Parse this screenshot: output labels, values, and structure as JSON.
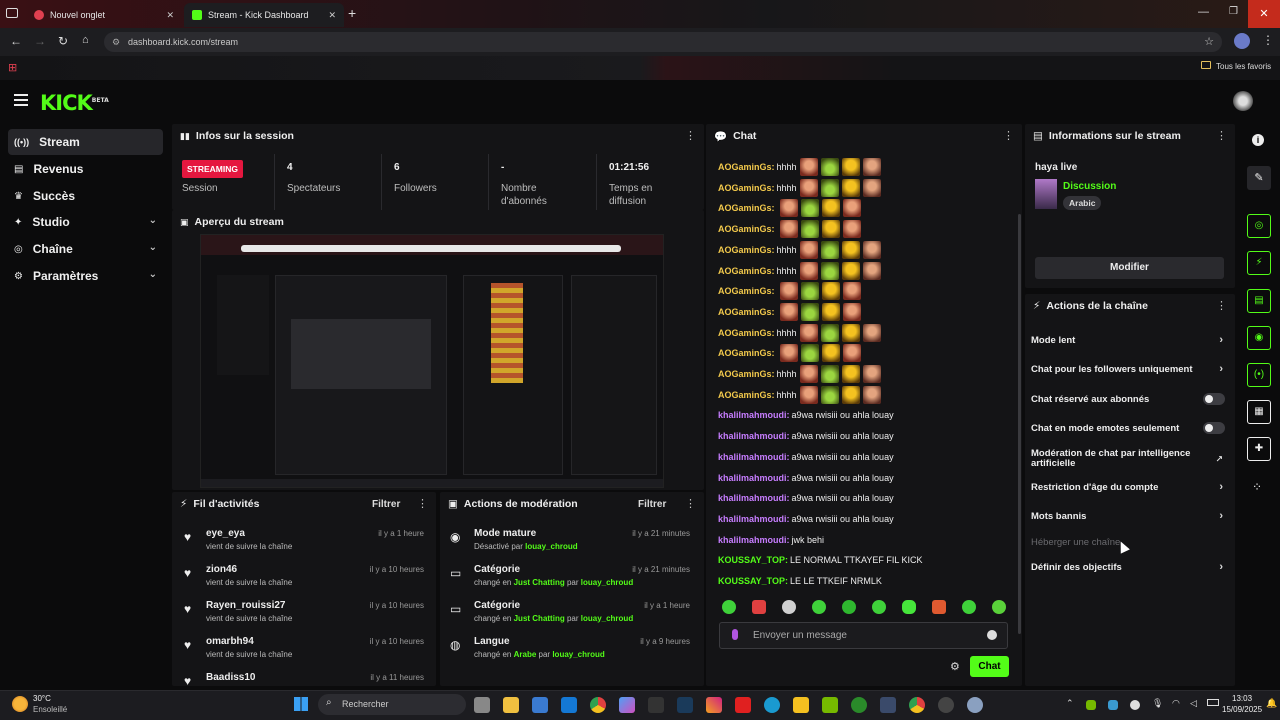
{
  "browser": {
    "tabs": [
      {
        "title": "Nouvel onglet"
      },
      {
        "title": "Stream - Kick Dashboard"
      }
    ],
    "url": "dashboard.kick.com/stream",
    "bookmarks_label": "Tous les favoris"
  },
  "kick": {
    "logo": "KICK",
    "logo_badge": "BETA"
  },
  "sidebar": {
    "items": [
      {
        "label": "Stream",
        "icon": "stream-icon"
      },
      {
        "label": "Revenus",
        "icon": "revenue-icon"
      },
      {
        "label": "Succès",
        "icon": "trophy-icon"
      },
      {
        "label": "Studio",
        "icon": "studio-icon"
      },
      {
        "label": "Chaîne",
        "icon": "channel-icon"
      },
      {
        "label": "Paramètres",
        "icon": "gear-icon"
      }
    ]
  },
  "session": {
    "title": "Infos sur la session",
    "badge": "STREAMING",
    "badge_sub": "Session",
    "stats": [
      {
        "value": "4",
        "label": "Spectateurs"
      },
      {
        "value": "6",
        "label": "Followers"
      },
      {
        "value": "-",
        "label": "Nombre d'abonnés"
      },
      {
        "value": "01:21:56",
        "label": "Temps en diffusion"
      }
    ]
  },
  "preview": {
    "title": "Aperçu du stream"
  },
  "feed": {
    "title": "Fil d'activités",
    "filter": "Filtrer",
    "items": [
      {
        "name": "eye_eya",
        "sub": "vient de suivre la chaîne",
        "time": "il y a 1 heure"
      },
      {
        "name": "zion46",
        "sub": "vient de suivre la chaîne",
        "time": "il y a 10 heures"
      },
      {
        "name": "Rayen_rouissi27",
        "sub": "vient de suivre la chaîne",
        "time": "il y a 10 heures"
      },
      {
        "name": "omarbh94",
        "sub": "vient de suivre la chaîne",
        "time": "il y a 10 heures"
      },
      {
        "name": "Baadiss10",
        "sub": "",
        "time": "il y a 11 heures"
      }
    ]
  },
  "moderation": {
    "title": "Actions de modération",
    "filter": "Filtrer",
    "items": [
      {
        "name": "Mode mature",
        "pre": "Désactivé par",
        "g1": "louay_chroud",
        "mid": "",
        "g2": "",
        "time": "il y a 21 minutes",
        "icon": "eye-icon"
      },
      {
        "name": "Catégorie",
        "pre": "changé en",
        "g1": "Just Chatting",
        "mid": "par",
        "g2": "louay_chroud",
        "time": "il y a 21 minutes",
        "icon": "category-icon"
      },
      {
        "name": "Catégorie",
        "pre": "changé en",
        "g1": "Just Chatting",
        "mid": "par",
        "g2": "louay_chroud",
        "time": "il y a 1 heure",
        "icon": "category-icon"
      },
      {
        "name": "Langue",
        "pre": "changé en",
        "g1": "Arabe",
        "mid": "par",
        "g2": "louay_chroud",
        "time": "il y a 9 heures",
        "icon": "globe-icon"
      }
    ]
  },
  "chat": {
    "title": "Chat",
    "messages": [
      {
        "user": "AOGaminGs:",
        "text": " hhhh",
        "color": "#f2c94c",
        "emotes": [
          "a",
          "b",
          "c",
          "d"
        ]
      },
      {
        "user": "AOGaminGs:",
        "text": " hhhh",
        "color": "#f2c94c",
        "emotes": [
          "a",
          "b",
          "c",
          "d"
        ]
      },
      {
        "user": "AOGaminGs:",
        "text": "",
        "color": "#f2c94c",
        "emotes": [
          "a",
          "b",
          "c",
          "a"
        ]
      },
      {
        "user": "AOGaminGs:",
        "text": "",
        "color": "#f2c94c",
        "emotes": [
          "a",
          "b",
          "c",
          "a"
        ]
      },
      {
        "user": "AOGaminGs:",
        "text": " hhhh",
        "color": "#f2c94c",
        "emotes": [
          "a",
          "b",
          "c",
          "d"
        ]
      },
      {
        "user": "AOGaminGs:",
        "text": " hhhh",
        "color": "#f2c94c",
        "emotes": [
          "a",
          "b",
          "c",
          "d"
        ]
      },
      {
        "user": "AOGaminGs:",
        "text": "",
        "color": "#f2c94c",
        "emotes": [
          "a",
          "b",
          "c",
          "a"
        ]
      },
      {
        "user": "AOGaminGs:",
        "text": "",
        "color": "#f2c94c",
        "emotes": [
          "a",
          "b",
          "c",
          "a"
        ]
      },
      {
        "user": "AOGaminGs:",
        "text": " hhhh",
        "color": "#f2c94c",
        "emotes": [
          "a",
          "b",
          "c",
          "d"
        ]
      },
      {
        "user": "AOGaminGs:",
        "text": "",
        "color": "#f2c94c",
        "emotes": [
          "a",
          "b",
          "c",
          "a"
        ]
      },
      {
        "user": "AOGaminGs:",
        "text": " hhhh",
        "color": "#f2c94c",
        "emotes": [
          "a",
          "b",
          "c",
          "d"
        ]
      },
      {
        "user": "AOGaminGs:",
        "text": " hhhh",
        "color": "#f2c94c",
        "emotes": [
          "a",
          "b",
          "c",
          "d"
        ]
      },
      {
        "user": "khalilmahmoudi:",
        "text": " a9wa rwisiii ou ahla louay",
        "color": "#c77dff",
        "emotes": []
      },
      {
        "user": "khalilmahmoudi:",
        "text": " a9wa rwisiii ou ahla louay",
        "color": "#c77dff",
        "emotes": []
      },
      {
        "user": "khalilmahmoudi:",
        "text": " a9wa rwisiii ou ahla louay",
        "color": "#c77dff",
        "emotes": []
      },
      {
        "user": "khalilmahmoudi:",
        "text": " a9wa rwisiii ou ahla louay",
        "color": "#c77dff",
        "emotes": []
      },
      {
        "user": "khalilmahmoudi:",
        "text": " a9wa rwisiii ou ahla louay",
        "color": "#c77dff",
        "emotes": []
      },
      {
        "user": "khalilmahmoudi:",
        "text": " a9wa rwisiii ou ahla louay",
        "color": "#c77dff",
        "emotes": []
      },
      {
        "user": "khalilmahmoudi:",
        "text": " jwk behi",
        "color": "#c77dff",
        "emotes": []
      },
      {
        "user": "KOUSSAY_TOP:",
        "text": " LE NORMAL TTKAYEF FIL KICK",
        "color": "#53fc18",
        "emotes": []
      },
      {
        "user": "KOUSSAY_TOP:",
        "text": " LE LE TTKEIF NRMLK",
        "color": "#53fc18",
        "emotes": []
      }
    ],
    "placeholder": "Envoyer un message",
    "send_label": "Chat"
  },
  "stream_info": {
    "title": "Informations sur le stream",
    "stream_title": "haya live",
    "category": "Discussion",
    "language": "Arabic",
    "edit_label": "Modifier"
  },
  "channel_actions": {
    "title": "Actions de la chaîne",
    "items": [
      {
        "label": "Mode lent",
        "kind": "chevron"
      },
      {
        "label": "Chat pour les followers uniquement",
        "kind": "chevron"
      },
      {
        "label": "Chat réservé aux abonnés",
        "kind": "toggle"
      },
      {
        "label": "Chat en mode emotes seulement",
        "kind": "toggle"
      },
      {
        "label": "Modération de chat par intelligence artificielle",
        "kind": "external"
      },
      {
        "label": "Restriction d'âge du compte",
        "kind": "chevron"
      },
      {
        "label": "Mots bannis",
        "kind": "chevron"
      },
      {
        "label": "Héberger une chaîne",
        "kind": "disabled"
      },
      {
        "label": "Définir des objectifs",
        "kind": "chevron"
      }
    ]
  },
  "taskbar": {
    "weather_temp": "30°C",
    "weather_desc": "Ensoleillé",
    "search_label": "Rechercher",
    "time": "13:03",
    "date": "15/09/2025"
  },
  "colors": {
    "accent": "#53fc18",
    "streaming": "#e5173f"
  }
}
